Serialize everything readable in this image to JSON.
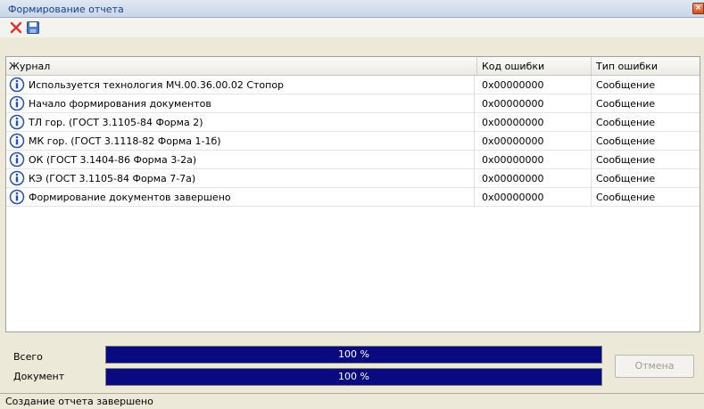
{
  "window": {
    "title": "Формирование отчета",
    "close_glyph": "×"
  },
  "toolbar": {
    "delete_icon": "delete-icon",
    "save_icon": "save-icon"
  },
  "grid": {
    "headers": {
      "journal": "Журнал",
      "code": "Код ошибки",
      "type": "Тип ошибки"
    },
    "rows": [
      {
        "message": "Используется технология МЧ.00.36.00.02 Стопор",
        "code": "0x00000000",
        "type": "Сообщение"
      },
      {
        "message": "Начало формирования документов",
        "code": "0x00000000",
        "type": "Сообщение"
      },
      {
        "message": "ТЛ гор. (ГОСТ 3.1105-84 Форма 2)",
        "code": "0x00000000",
        "type": "Сообщение"
      },
      {
        "message": "МК гор. (ГОСТ 3.1118-82 Форма 1-1б)",
        "code": "0x00000000",
        "type": "Сообщение"
      },
      {
        "message": "ОК (ГОСТ 3.1404-86 Форма 3-2а)",
        "code": "0x00000000",
        "type": "Сообщение"
      },
      {
        "message": "КЭ (ГОСТ 3.1105-84 Форма 7-7а)",
        "code": "0x00000000",
        "type": "Сообщение"
      },
      {
        "message": "Формирование документов завершено",
        "code": "0x00000000",
        "type": "Сообщение"
      }
    ]
  },
  "progress": {
    "total": {
      "label": "Всего",
      "text": "100 %",
      "fraction": 1.0
    },
    "document": {
      "label": "Документ",
      "text": "100 %",
      "fraction": 1.0
    }
  },
  "buttons": {
    "cancel_label": "Отмена"
  },
  "status": {
    "text": "Создание отчета завершено"
  },
  "colors": {
    "progress_fill": "#0a0a80",
    "title_text": "#15428b"
  }
}
